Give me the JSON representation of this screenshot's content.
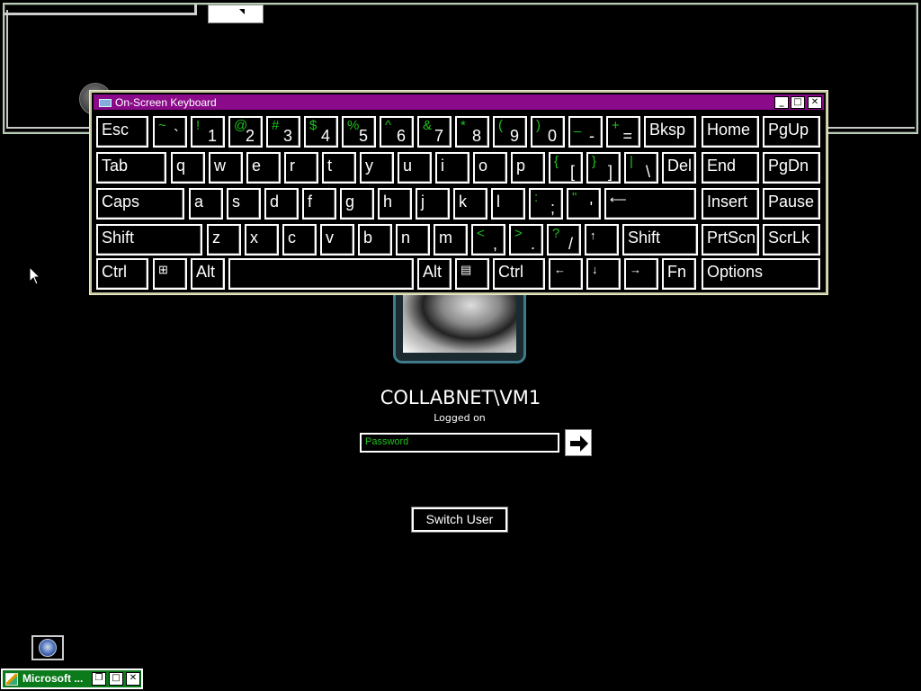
{
  "keyboard_window": {
    "title": "On-Screen Keyboard",
    "controls": {
      "minimize": "_",
      "maximize": "□",
      "close": "✕"
    }
  },
  "keys": {
    "row1": [
      {
        "label": "Esc"
      },
      {
        "shift": "~",
        "base": "`"
      },
      {
        "shift": "!",
        "base": "1"
      },
      {
        "shift": "@",
        "base": "2"
      },
      {
        "shift": "#",
        "base": "3"
      },
      {
        "shift": "$",
        "base": "4"
      },
      {
        "shift": "%",
        "base": "5"
      },
      {
        "shift": "^",
        "base": "6"
      },
      {
        "shift": "&",
        "base": "7"
      },
      {
        "shift": "*",
        "base": "8"
      },
      {
        "shift": "(",
        "base": "9"
      },
      {
        "shift": ")",
        "base": "0"
      },
      {
        "shift": "_",
        "base": "-"
      },
      {
        "shift": "+",
        "base": "="
      },
      {
        "label": "Bksp"
      },
      {
        "label": "Home"
      },
      {
        "label": "PgUp"
      }
    ],
    "row2": [
      {
        "label": "Tab"
      },
      {
        "label": "q"
      },
      {
        "label": "w"
      },
      {
        "label": "e"
      },
      {
        "label": "r"
      },
      {
        "label": "t"
      },
      {
        "label": "y"
      },
      {
        "label": "u"
      },
      {
        "label": "i"
      },
      {
        "label": "o"
      },
      {
        "label": "p"
      },
      {
        "shift": "{",
        "base": "["
      },
      {
        "shift": "}",
        "base": "]"
      },
      {
        "shift": "|",
        "base": "\\"
      },
      {
        "label": "Del"
      },
      {
        "label": "End"
      },
      {
        "label": "PgDn"
      }
    ],
    "row3": [
      {
        "label": "Caps"
      },
      {
        "label": "a"
      },
      {
        "label": "s"
      },
      {
        "label": "d"
      },
      {
        "label": "f"
      },
      {
        "label": "g"
      },
      {
        "label": "h"
      },
      {
        "label": "j"
      },
      {
        "label": "k"
      },
      {
        "label": "l"
      },
      {
        "shift": ":",
        "base": ";"
      },
      {
        "shift": "\"",
        "base": "'"
      },
      {
        "label": "⟵"
      },
      {
        "label": "Insert"
      },
      {
        "label": "Pause"
      }
    ],
    "row4": [
      {
        "label": "Shift"
      },
      {
        "label": "z"
      },
      {
        "label": "x"
      },
      {
        "label": "c"
      },
      {
        "label": "v"
      },
      {
        "label": "b"
      },
      {
        "label": "n"
      },
      {
        "label": "m"
      },
      {
        "shift": "<",
        "base": ","
      },
      {
        "shift": ">",
        "base": "."
      },
      {
        "shift": "?",
        "base": "/"
      },
      {
        "label": "↑"
      },
      {
        "label": "Shift"
      },
      {
        "label": "PrtScn"
      },
      {
        "label": "ScrLk"
      }
    ],
    "row5": [
      {
        "label": "Ctrl"
      },
      {
        "label": "⊞"
      },
      {
        "label": "Alt"
      },
      {
        "label": ""
      },
      {
        "label": "Alt"
      },
      {
        "label": "▤"
      },
      {
        "label": "Ctrl"
      },
      {
        "label": "←"
      },
      {
        "label": "↓"
      },
      {
        "label": "→"
      },
      {
        "label": "Fn"
      },
      {
        "label": "Options"
      }
    ]
  },
  "login": {
    "username": "COLLABNET\\VM1",
    "status": "Logged on",
    "password_placeholder": "Password",
    "switch_user_label": "Switch User"
  },
  "taskbar": {
    "minimized_title": "Microsoft ...",
    "controls": {
      "restore": "❐",
      "maximize": "□",
      "close": "✕"
    }
  },
  "colors": {
    "title_bar": "#8a0a8a",
    "shift_chars": "#1ec21e",
    "minimized_window": "#0b7a1b"
  }
}
